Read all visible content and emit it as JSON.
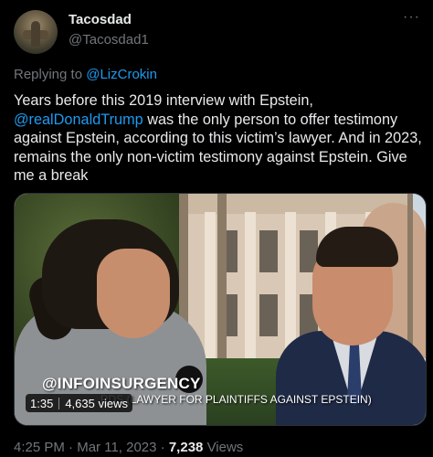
{
  "author": {
    "name": "Tacosdad",
    "handle": "@Tacosdad1",
    "avatar_icon": "avatar-image"
  },
  "more_icon": "···",
  "reply": {
    "prefix": "Replying to",
    "to": "@LizCrokin"
  },
  "tweet": {
    "line1": "Years before this 2019 interview with Epstein,",
    "mention": "@realDonaldTrump",
    "rest": " was the only person to offer testimony against Epstein, according to this victim’s lawyer. And in 2023, remains the only non-victim testimony against Epstein. Give me a break"
  },
  "video": {
    "overlay_title": "@INFOINSURGENCY",
    "overlay_caption": "RDS (LAWYER FOR PLAINTIFFS AGAINST EPSTEIN)",
    "duration": "1:35",
    "views": "4,635 views"
  },
  "meta": {
    "time": "4:25 PM",
    "dot": "·",
    "date": "Mar 11, 2023",
    "view_count": "7,238",
    "views_label": "Views"
  },
  "colors": {
    "background": "#000000",
    "text": "#e7e9ea",
    "muted": "#71767b",
    "link": "#1d9bf0"
  }
}
